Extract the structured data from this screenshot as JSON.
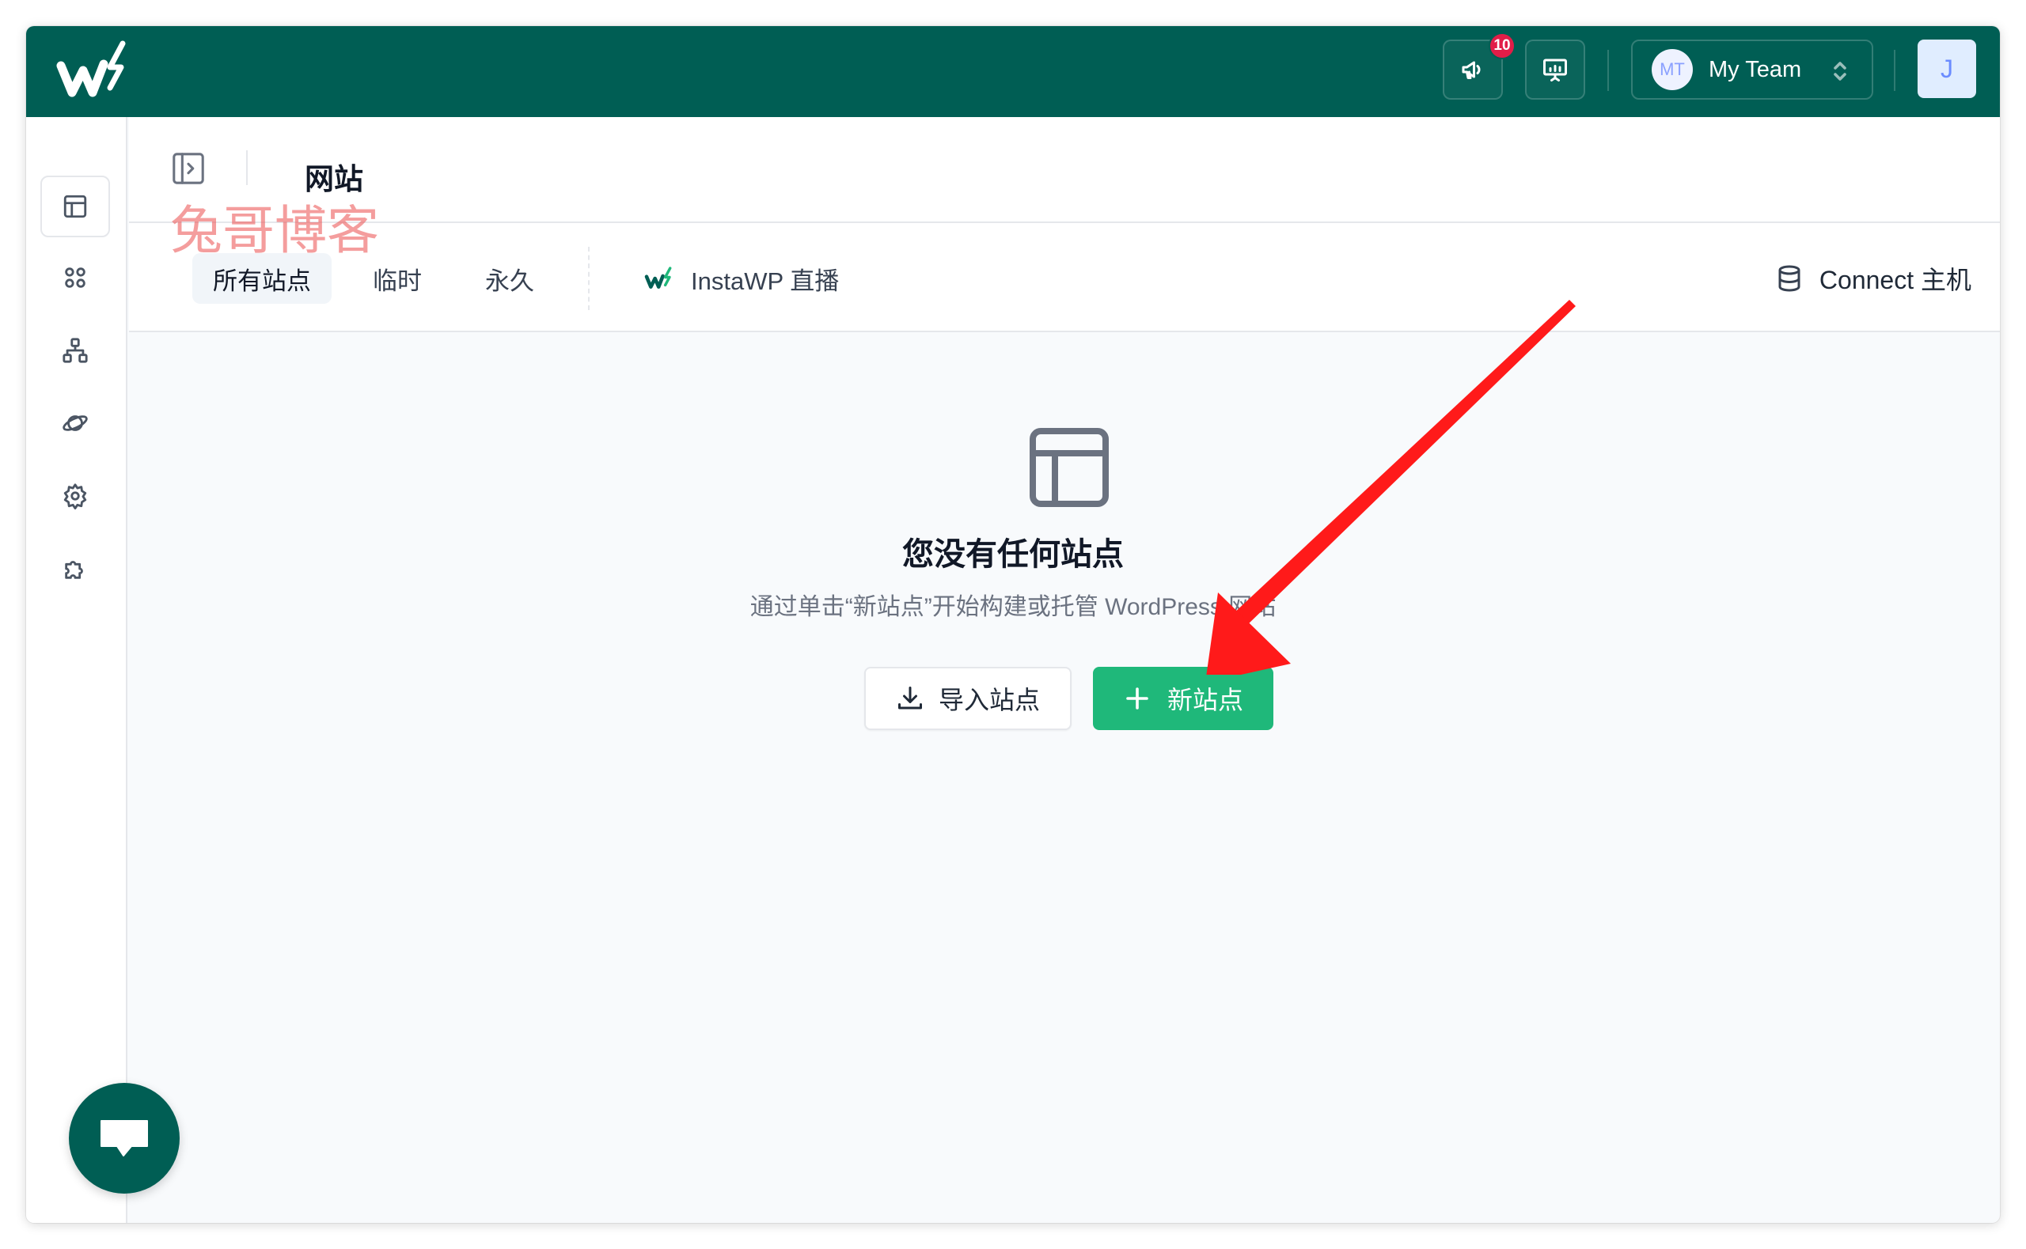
{
  "topbar": {
    "notification_count": "10",
    "team": {
      "initials": "MT",
      "name": "My Team"
    },
    "user_initial": "J"
  },
  "header": {
    "title": "网站",
    "watermark": "兔哥博客"
  },
  "tabs": [
    {
      "label": "所有站点",
      "active": true
    },
    {
      "label": "临时",
      "active": false
    },
    {
      "label": "永久",
      "active": false
    }
  ],
  "instawp_tab": {
    "label": "InstaWP 直播"
  },
  "connect": {
    "label": "Connect 主机"
  },
  "empty_state": {
    "title": "您没有任何站点",
    "subtitle": "通过单击“新站点”开始构建或托管 WordPress 网站"
  },
  "actions": {
    "import_label": "导入站点",
    "new_label": "新站点"
  },
  "colors": {
    "brand": "#005e54",
    "primary_button": "#1fb87a",
    "badge": "#e11d48",
    "annotation_arrow": "#ff1a1a"
  },
  "icons": {
    "sidebar": [
      "sites-icon",
      "apps-grid-icon",
      "network-icon",
      "planet-icon",
      "settings-gear-icon",
      "integrations-puzzle-icon"
    ],
    "topbar": [
      "megaphone-icon",
      "presentation-icon",
      "chevron-updown-icon"
    ]
  }
}
